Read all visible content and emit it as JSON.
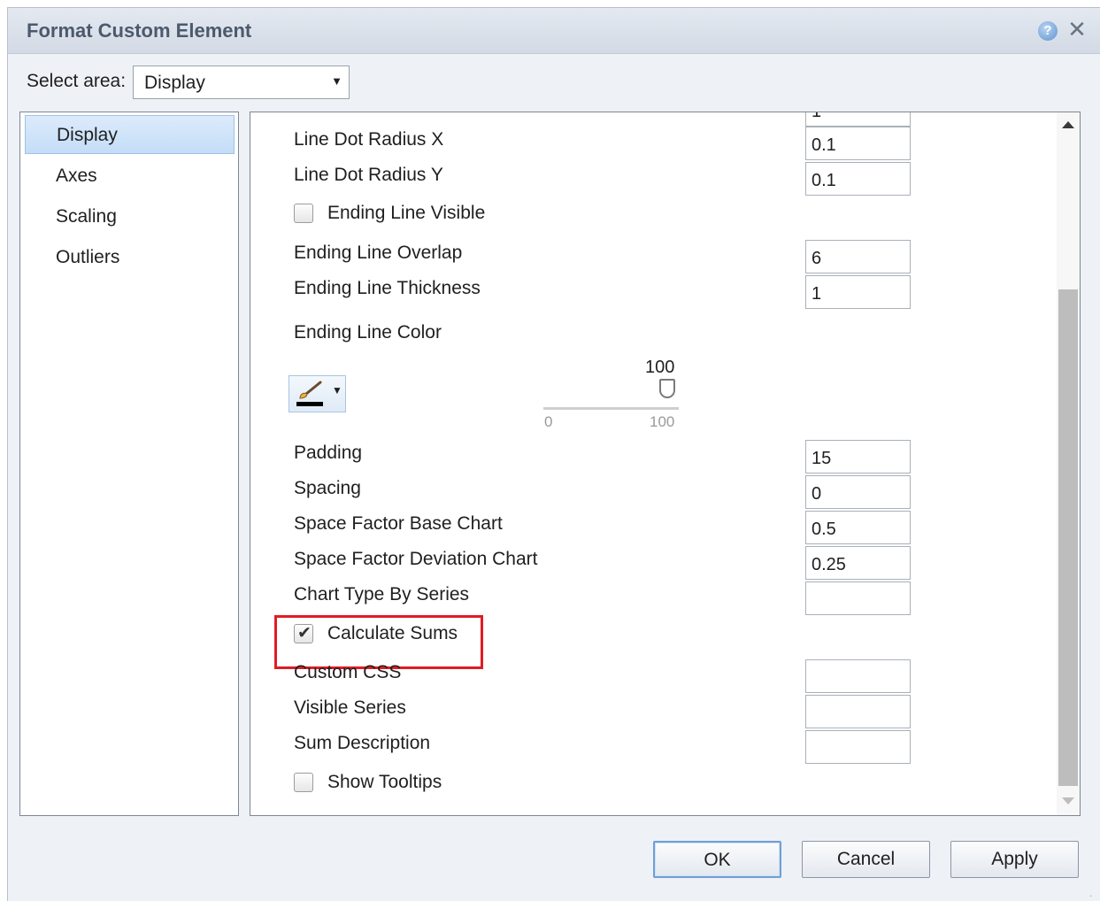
{
  "dialog": {
    "title": "Format Custom Element",
    "help_icon": "?",
    "close_icon": "✕"
  },
  "select_area": {
    "label": "Select area:",
    "value": "Display"
  },
  "nav": {
    "items": [
      {
        "label": "Display",
        "selected": true
      },
      {
        "label": "Axes",
        "selected": false
      },
      {
        "label": "Scaling",
        "selected": false
      },
      {
        "label": "Outliers",
        "selected": false
      }
    ]
  },
  "properties": {
    "top_partial_value": "1",
    "line_dot_radius_x": {
      "label": "Line Dot Radius X",
      "value": "0.1"
    },
    "line_dot_radius_y": {
      "label": "Line Dot Radius Y",
      "value": "0.1"
    },
    "ending_line_visible": {
      "label": "Ending Line Visible",
      "checked": false
    },
    "ending_line_overlap": {
      "label": "Ending Line Overlap",
      "value": "6"
    },
    "ending_line_thickness": {
      "label": "Ending Line Thickness",
      "value": "1"
    },
    "ending_line_color": {
      "label": "Ending Line Color"
    },
    "transparency_slider": {
      "value": "100",
      "min": "0",
      "max": "100"
    },
    "padding": {
      "label": "Padding",
      "value": "15"
    },
    "spacing": {
      "label": "Spacing",
      "value": "0"
    },
    "space_factor_base_chart": {
      "label": "Space Factor Base Chart",
      "value": "0.5"
    },
    "space_factor_deviation_chart": {
      "label": "Space Factor Deviation Chart",
      "value": "0.25"
    },
    "chart_type_by_series": {
      "label": "Chart Type By Series",
      "value": ""
    },
    "calculate_sums": {
      "label": "Calculate Sums",
      "checked": true
    },
    "custom_css": {
      "label": "Custom CSS",
      "value": ""
    },
    "visible_series": {
      "label": "Visible Series",
      "value": ""
    },
    "sum_description": {
      "label": "Sum Description",
      "value": ""
    },
    "show_tooltips": {
      "label": "Show Tooltips",
      "checked": false
    }
  },
  "buttons": {
    "ok": "OK",
    "cancel": "Cancel",
    "apply": "Apply"
  },
  "icons": {
    "checked_mark": "✔",
    "dropdown_arrow": "▼"
  },
  "colors": {
    "highlight": "#e01c24",
    "selected_nav_bg": "#c4ddf7",
    "title_text": "#4b5a6c"
  }
}
